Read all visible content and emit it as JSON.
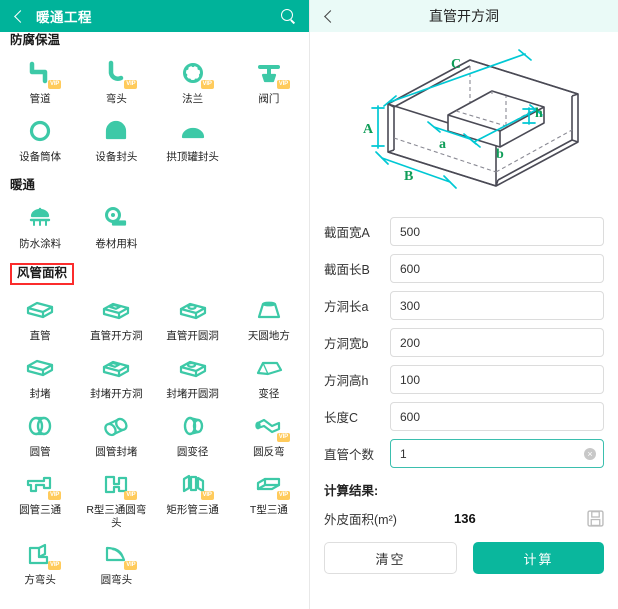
{
  "left": {
    "header": {
      "title": "暖通工程",
      "back_icon": "back-chevron-icon",
      "search_icon": "search-icon"
    },
    "sections": [
      {
        "title": "防腐保温",
        "boxed": false,
        "clipped": true,
        "items": [
          {
            "label": "管道",
            "icon": "pipe-icon",
            "vip": "VIP"
          },
          {
            "label": "弯头",
            "icon": "elbow-icon",
            "vip": "VIP"
          },
          {
            "label": "法兰",
            "icon": "flange-icon",
            "vip": "VIP"
          },
          {
            "label": "阀门",
            "icon": "valve-icon",
            "vip": "VIP"
          },
          {
            "label": "设备筒体",
            "icon": "cylinder-icon",
            "vip": ""
          },
          {
            "label": "设备封头",
            "icon": "head-cap-icon",
            "vip": ""
          },
          {
            "label": "拱顶罐封头",
            "icon": "dome-tank-icon",
            "vip": ""
          }
        ]
      },
      {
        "title": "暖通",
        "boxed": false,
        "clipped": false,
        "items": [
          {
            "label": "防水涂料",
            "icon": "waterproof-coating-icon",
            "vip": ""
          },
          {
            "label": "卷材用料",
            "icon": "roll-material-icon",
            "vip": ""
          }
        ]
      },
      {
        "title": "风管面积",
        "boxed": true,
        "clipped": false,
        "items": [
          {
            "label": "直管",
            "icon": "straight-duct-icon",
            "vip": ""
          },
          {
            "label": "直管开方洞",
            "icon": "straight-duct-square-hole-icon",
            "vip": ""
          },
          {
            "label": "直管开圆洞",
            "icon": "straight-duct-round-hole-icon",
            "vip": ""
          },
          {
            "label": "天圆地方",
            "icon": "round-to-square-icon",
            "vip": ""
          },
          {
            "label": "封堵",
            "icon": "cap-icon",
            "vip": ""
          },
          {
            "label": "封堵开方洞",
            "icon": "cap-square-hole-icon",
            "vip": ""
          },
          {
            "label": "封堵开圆洞",
            "icon": "cap-round-hole-icon",
            "vip": ""
          },
          {
            "label": "变径",
            "icon": "reducer-icon",
            "vip": ""
          },
          {
            "label": "圆管",
            "icon": "round-duct-icon",
            "vip": ""
          },
          {
            "label": "圆管封堵",
            "icon": "round-duct-cap-icon",
            "vip": ""
          },
          {
            "label": "圆变径",
            "icon": "round-reducer-icon",
            "vip": ""
          },
          {
            "label": "圆反弯",
            "icon": "round-reverse-bend-icon",
            "vip": "VIP"
          },
          {
            "label": "圆管三通",
            "icon": "round-duct-tee-icon",
            "vip": "VIP"
          },
          {
            "label": "R型三通圆弯头",
            "icon": "r-type-tee-elbow-icon",
            "vip": "VIP"
          },
          {
            "label": "矩形管三通",
            "icon": "rect-duct-tee-icon",
            "vip": "VIP"
          },
          {
            "label": "T型三通",
            "icon": "t-type-tee-icon",
            "vip": "VIP"
          },
          {
            "label": "方弯头",
            "icon": "square-elbow-icon",
            "vip": "VIP"
          },
          {
            "label": "圆弯头",
            "icon": "round-elbow-icon",
            "vip": "VIP"
          }
        ]
      }
    ]
  },
  "right": {
    "header": {
      "title": "直管开方洞",
      "back_icon": "back-chevron-icon"
    },
    "diagram": {
      "name": "duct-square-hole-isometric-diagram",
      "labels": [
        "A",
        "B",
        "C",
        "a",
        "b",
        "h"
      ]
    },
    "fields": [
      {
        "label": "截面宽A",
        "value": "500",
        "focused": false
      },
      {
        "label": "截面长B",
        "value": "600",
        "focused": false
      },
      {
        "label": "方洞长a",
        "value": "300",
        "focused": false
      },
      {
        "label": "方洞宽b",
        "value": "200",
        "focused": false
      },
      {
        "label": "方洞高h",
        "value": "100",
        "focused": false
      },
      {
        "label": "长度C",
        "value": "600",
        "focused": false
      },
      {
        "label": "直管个数",
        "value": "1",
        "focused": true
      }
    ],
    "result": {
      "title": "计算结果:",
      "label": "外皮面积(m²)",
      "value": "136",
      "save_icon": "save-floppy-icon"
    },
    "buttons": {
      "clear": "清空",
      "calculate": "计算"
    }
  },
  "colors": {
    "brand_teal": "#00b39a",
    "header_light": "#eafaf7",
    "icon_green": "#3dc9a7",
    "vip_badge": "#ffcb5c",
    "highlight_red": "#fb2c2c",
    "diagram_cyan": "#00c8d4",
    "diagram_green": "#0f9d58"
  }
}
